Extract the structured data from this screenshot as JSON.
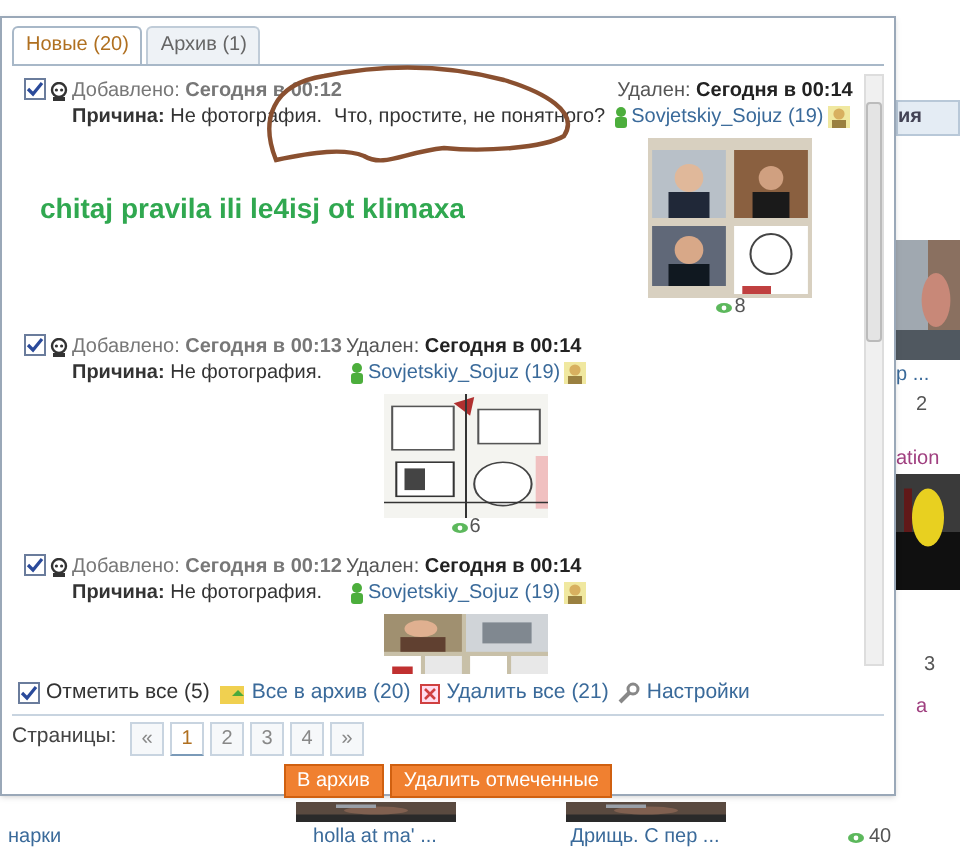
{
  "background": {
    "tab": "ия",
    "side_texts": [
      "р ...",
      "2",
      "ation",
      "3",
      "а"
    ],
    "captions": [
      "нарки",
      "holla at ma' ...",
      "Дрищь. С пер ..."
    ],
    "views": "40"
  },
  "tabs": [
    {
      "label": "Новые (20)",
      "selected": true
    },
    {
      "label": "Архив (1)",
      "selected": false
    }
  ],
  "entries": [
    {
      "checked": true,
      "added_label": "Добавлено:",
      "added": "Сегодня в 00:12",
      "deleted_label": "Удален:",
      "deleted": "Сегодня в 00:14",
      "reason_label": "Причина:",
      "reason": "Не фотография.",
      "comment": "Что, простите, не понятного?",
      "user": "Sovjetskiy_Sojuz (19)",
      "views": "8",
      "kind": "picture"
    },
    {
      "checked": true,
      "added_label": "Добавлено:",
      "added": "Сегодня в 00:13",
      "deleted_label": "Удален:",
      "deleted": "Сегодня в 00:14",
      "reason_label": "Причина:",
      "reason": "Не фотография.",
      "user": "Sovjetskiy_Sojuz (19)",
      "views": "6",
      "kind": "picture"
    },
    {
      "checked": true,
      "added_label": "Добавлено:",
      "added": "Сегодня в 00:12",
      "deleted_label": "Удален:",
      "deleted": "Сегодня в 00:14",
      "reason_label": "Причина:",
      "reason": "Не фотография.",
      "user": "Sovjetskiy_Sojuz (19)",
      "kind": "picture"
    }
  ],
  "annotation": {
    "text": "chitaj pravila ili le4isj ot klimaxa"
  },
  "footer": {
    "select_all": {
      "label": "Отметить все (5)",
      "checked": true
    },
    "archive_all": "Все в архив (20)",
    "delete_all": "Удалить все (21)",
    "settings": "Настройки"
  },
  "pagination": {
    "label": "Страницы:",
    "pages": [
      {
        "label": "«",
        "selected": false
      },
      {
        "label": "1",
        "selected": true
      },
      {
        "label": "2",
        "selected": false
      },
      {
        "label": "3",
        "selected": false
      },
      {
        "label": "4",
        "selected": false
      },
      {
        "label": "»",
        "selected": false
      }
    ]
  },
  "buttons": [
    "В архив",
    "Удалить отмеченные"
  ]
}
